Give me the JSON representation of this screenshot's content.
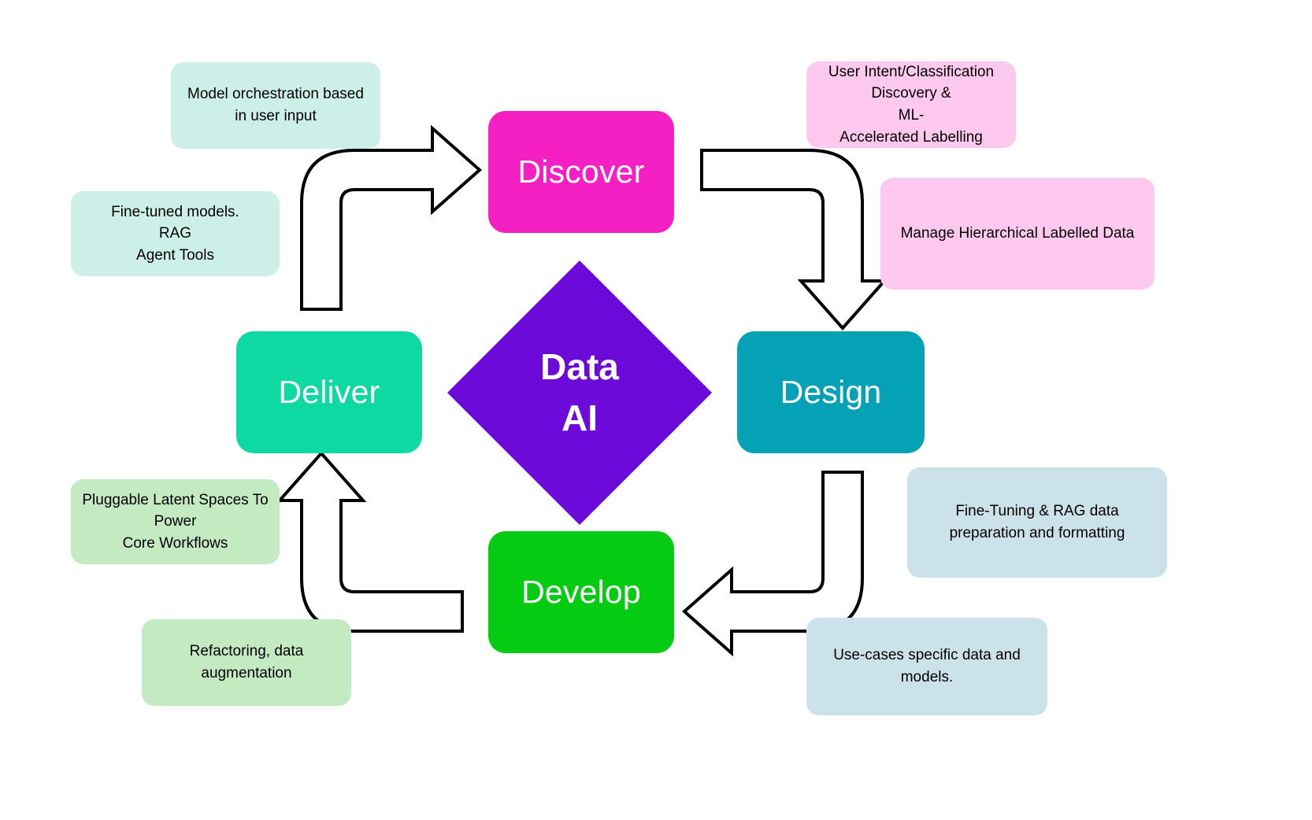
{
  "diagram": {
    "title": "Data AI lifecycle cycle diagram",
    "center": {
      "line1": "Data",
      "line2": "AI",
      "color": "#6C0BD9",
      "shape": "diamond"
    },
    "stages": [
      {
        "id": "discover",
        "label": "Discover",
        "color": "#F520C4",
        "position": "top"
      },
      {
        "id": "design",
        "label": "Design",
        "color": "#05A2B5",
        "position": "right"
      },
      {
        "id": "develop",
        "label": "Develop",
        "color": "#05CC12",
        "position": "bottom"
      },
      {
        "id": "deliver",
        "label": "Deliver",
        "color": "#0ED9A3",
        "position": "left"
      }
    ],
    "notes": [
      {
        "id": "model-orchestration",
        "text": "Model orchestration based\nin user input",
        "color": "#CCEFE8",
        "related_stage": "deliver"
      },
      {
        "id": "fine-tuned-models",
        "text": "Fine-tuned models.\nRAG\nAgent Tools",
        "color": "#CCEFE8",
        "related_stage": "deliver"
      },
      {
        "id": "user-intent",
        "text": "User Intent/Classification\nDiscovery &\nML-\nAccelerated Labelling",
        "color": "#FCC8EE",
        "related_stage": "discover"
      },
      {
        "id": "manage-hierarchical",
        "text": "Manage Hierarchical Labelled Data",
        "color": "#FCC8EE",
        "related_stage": "discover"
      },
      {
        "id": "pluggable-latent-spaces",
        "text": "Pluggable Latent Spaces To\nPower\nCore Workflows",
        "color": "#C3EAC0",
        "related_stage": "deliver"
      },
      {
        "id": "refactoring",
        "text": "Refactoring, data\naugmentation",
        "color": "#C3EAC0",
        "related_stage": "develop"
      },
      {
        "id": "fine-tuning-rag",
        "text": "Fine-Tuning & RAG data\npreparation and formatting",
        "color": "#CBE2EA",
        "related_stage": "design"
      },
      {
        "id": "use-cases",
        "text": "Use-cases specific data and\nmodels.",
        "color": "#CBE2EA",
        "related_stage": "develop"
      }
    ],
    "arrows": [
      {
        "id": "deliver-to-discover",
        "from": "deliver",
        "to": "discover",
        "style": "outlined-elbow"
      },
      {
        "id": "discover-to-design",
        "from": "discover",
        "to": "design",
        "style": "outlined-elbow"
      },
      {
        "id": "design-to-develop",
        "from": "design",
        "to": "develop",
        "style": "outlined-elbow"
      },
      {
        "id": "develop-to-deliver",
        "from": "develop",
        "to": "deliver",
        "style": "outlined-elbow"
      }
    ]
  }
}
